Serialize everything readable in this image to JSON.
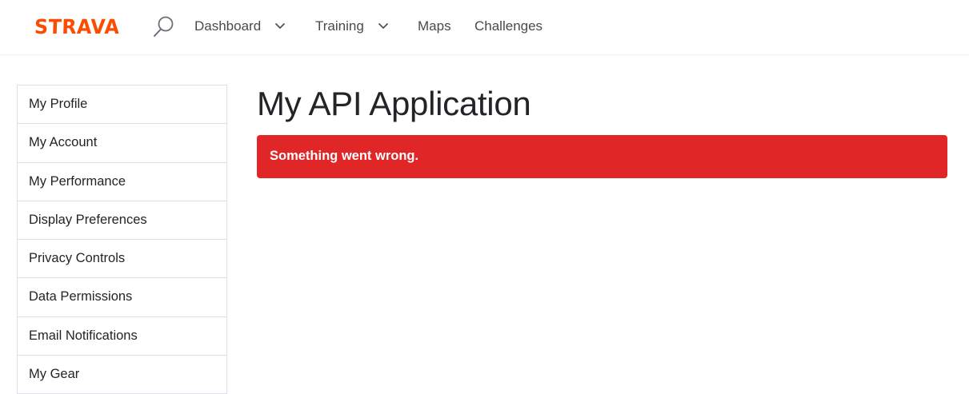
{
  "header": {
    "logo_text": "STRAVA",
    "brand_color": "#fc4c02",
    "search_icon": "search-icon",
    "nav": [
      {
        "label": "Dashboard",
        "has_dropdown": true
      },
      {
        "label": "Training",
        "has_dropdown": true
      },
      {
        "label": "Maps",
        "has_dropdown": false
      },
      {
        "label": "Challenges",
        "has_dropdown": false
      }
    ]
  },
  "sidebar": {
    "items": [
      {
        "label": "My Profile"
      },
      {
        "label": "My Account"
      },
      {
        "label": "My Performance"
      },
      {
        "label": "Display Preferences"
      },
      {
        "label": "Privacy Controls"
      },
      {
        "label": "Data Permissions"
      },
      {
        "label": "Email Notifications"
      },
      {
        "label": "My Gear"
      }
    ]
  },
  "main": {
    "title": "My API Application",
    "alert": {
      "message": "Something went wrong.",
      "color": "#e02626"
    }
  }
}
